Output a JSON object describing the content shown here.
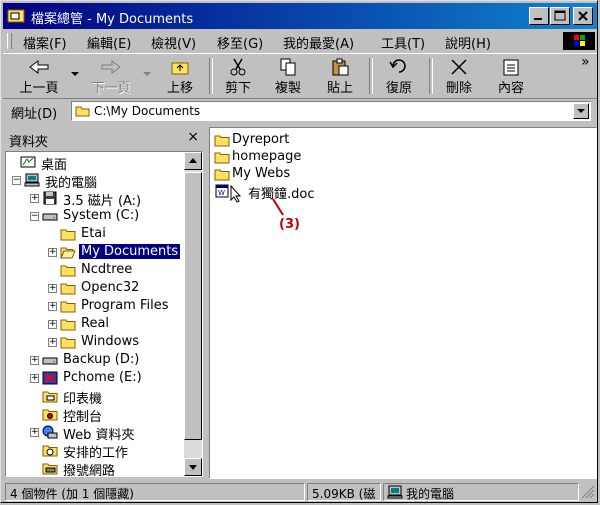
{
  "window": {
    "title": "檔案總管 - My Documents"
  },
  "menu": [
    "檔案(F)",
    "編輯(E)",
    "檢視(V)",
    "移至(G)",
    "我的最愛(A)",
    "工具(T)",
    "說明(H)"
  ],
  "toolbar": {
    "back": "上一頁",
    "forward": "下一頁",
    "up": "上移",
    "cut": "剪下",
    "copy": "複製",
    "paste": "貼上",
    "undo": "復原",
    "delete": "刪除",
    "properties": "內容",
    "more": "»"
  },
  "address": {
    "label": "網址(D)",
    "value": "C:\\My Documents"
  },
  "folders_pane": {
    "header": "資料夾",
    "close": "×",
    "tree": [
      {
        "label": "桌面",
        "icon": "desktop-icon",
        "level": 0,
        "expander": ""
      },
      {
        "label": "我的電腦",
        "icon": "computer-icon",
        "level": 1,
        "expander": "−"
      },
      {
        "label": "3.5 磁片 (A:)",
        "icon": "floppy-icon",
        "level": 2,
        "expander": "+"
      },
      {
        "label": "System (C:)",
        "icon": "drive-icon",
        "level": 2,
        "expander": "−"
      },
      {
        "label": "Etai",
        "icon": "folder-icon",
        "level": 3,
        "expander": ""
      },
      {
        "label": "My Documents",
        "icon": "open-folder-icon",
        "level": 3,
        "expander": "+",
        "selected": true
      },
      {
        "label": "Ncdtree",
        "icon": "folder-icon",
        "level": 3,
        "expander": ""
      },
      {
        "label": "Openc32",
        "icon": "folder-icon",
        "level": 3,
        "expander": "+"
      },
      {
        "label": "Program Files",
        "icon": "folder-icon",
        "level": 3,
        "expander": "+"
      },
      {
        "label": "Real",
        "icon": "folder-icon",
        "level": 3,
        "expander": "+"
      },
      {
        "label": "Windows",
        "icon": "folder-icon",
        "level": 3,
        "expander": "+"
      },
      {
        "label": "Backup (D:)",
        "icon": "drive-icon",
        "level": 2,
        "expander": "+"
      },
      {
        "label": "Pchome (E:)",
        "icon": "cdrom-icon",
        "level": 2,
        "expander": "+"
      },
      {
        "label": "印表機",
        "icon": "printer-folder-icon",
        "level": 2,
        "expander": ""
      },
      {
        "label": "控制台",
        "icon": "control-panel-icon",
        "level": 2,
        "expander": ""
      },
      {
        "label": "Web 資料夾",
        "icon": "web-folder-icon",
        "level": 2,
        "expander": "+"
      },
      {
        "label": "安排的工作",
        "icon": "tasks-folder-icon",
        "level": 2,
        "expander": ""
      },
      {
        "label": "撥號網路",
        "icon": "dialup-folder-icon",
        "level": 2,
        "expander": ""
      }
    ]
  },
  "files": [
    {
      "name": "Dyreport",
      "icon": "folder-icon"
    },
    {
      "name": "homepage",
      "icon": "folder-icon"
    },
    {
      "name": "My Webs",
      "icon": "folder-icon"
    },
    {
      "name": "有獨鐘.doc",
      "icon": "word-document-icon"
    }
  ],
  "annotation": {
    "label": "(3)"
  },
  "status": {
    "objects": "4 個物件 (加 1 個隱藏)",
    "size": "5.09KB (磁",
    "location": "我的電腦"
  },
  "colors": {
    "titlebar": "#000080",
    "selection": "#000080",
    "folder": "#ffe060",
    "annotation": "#c00000"
  }
}
